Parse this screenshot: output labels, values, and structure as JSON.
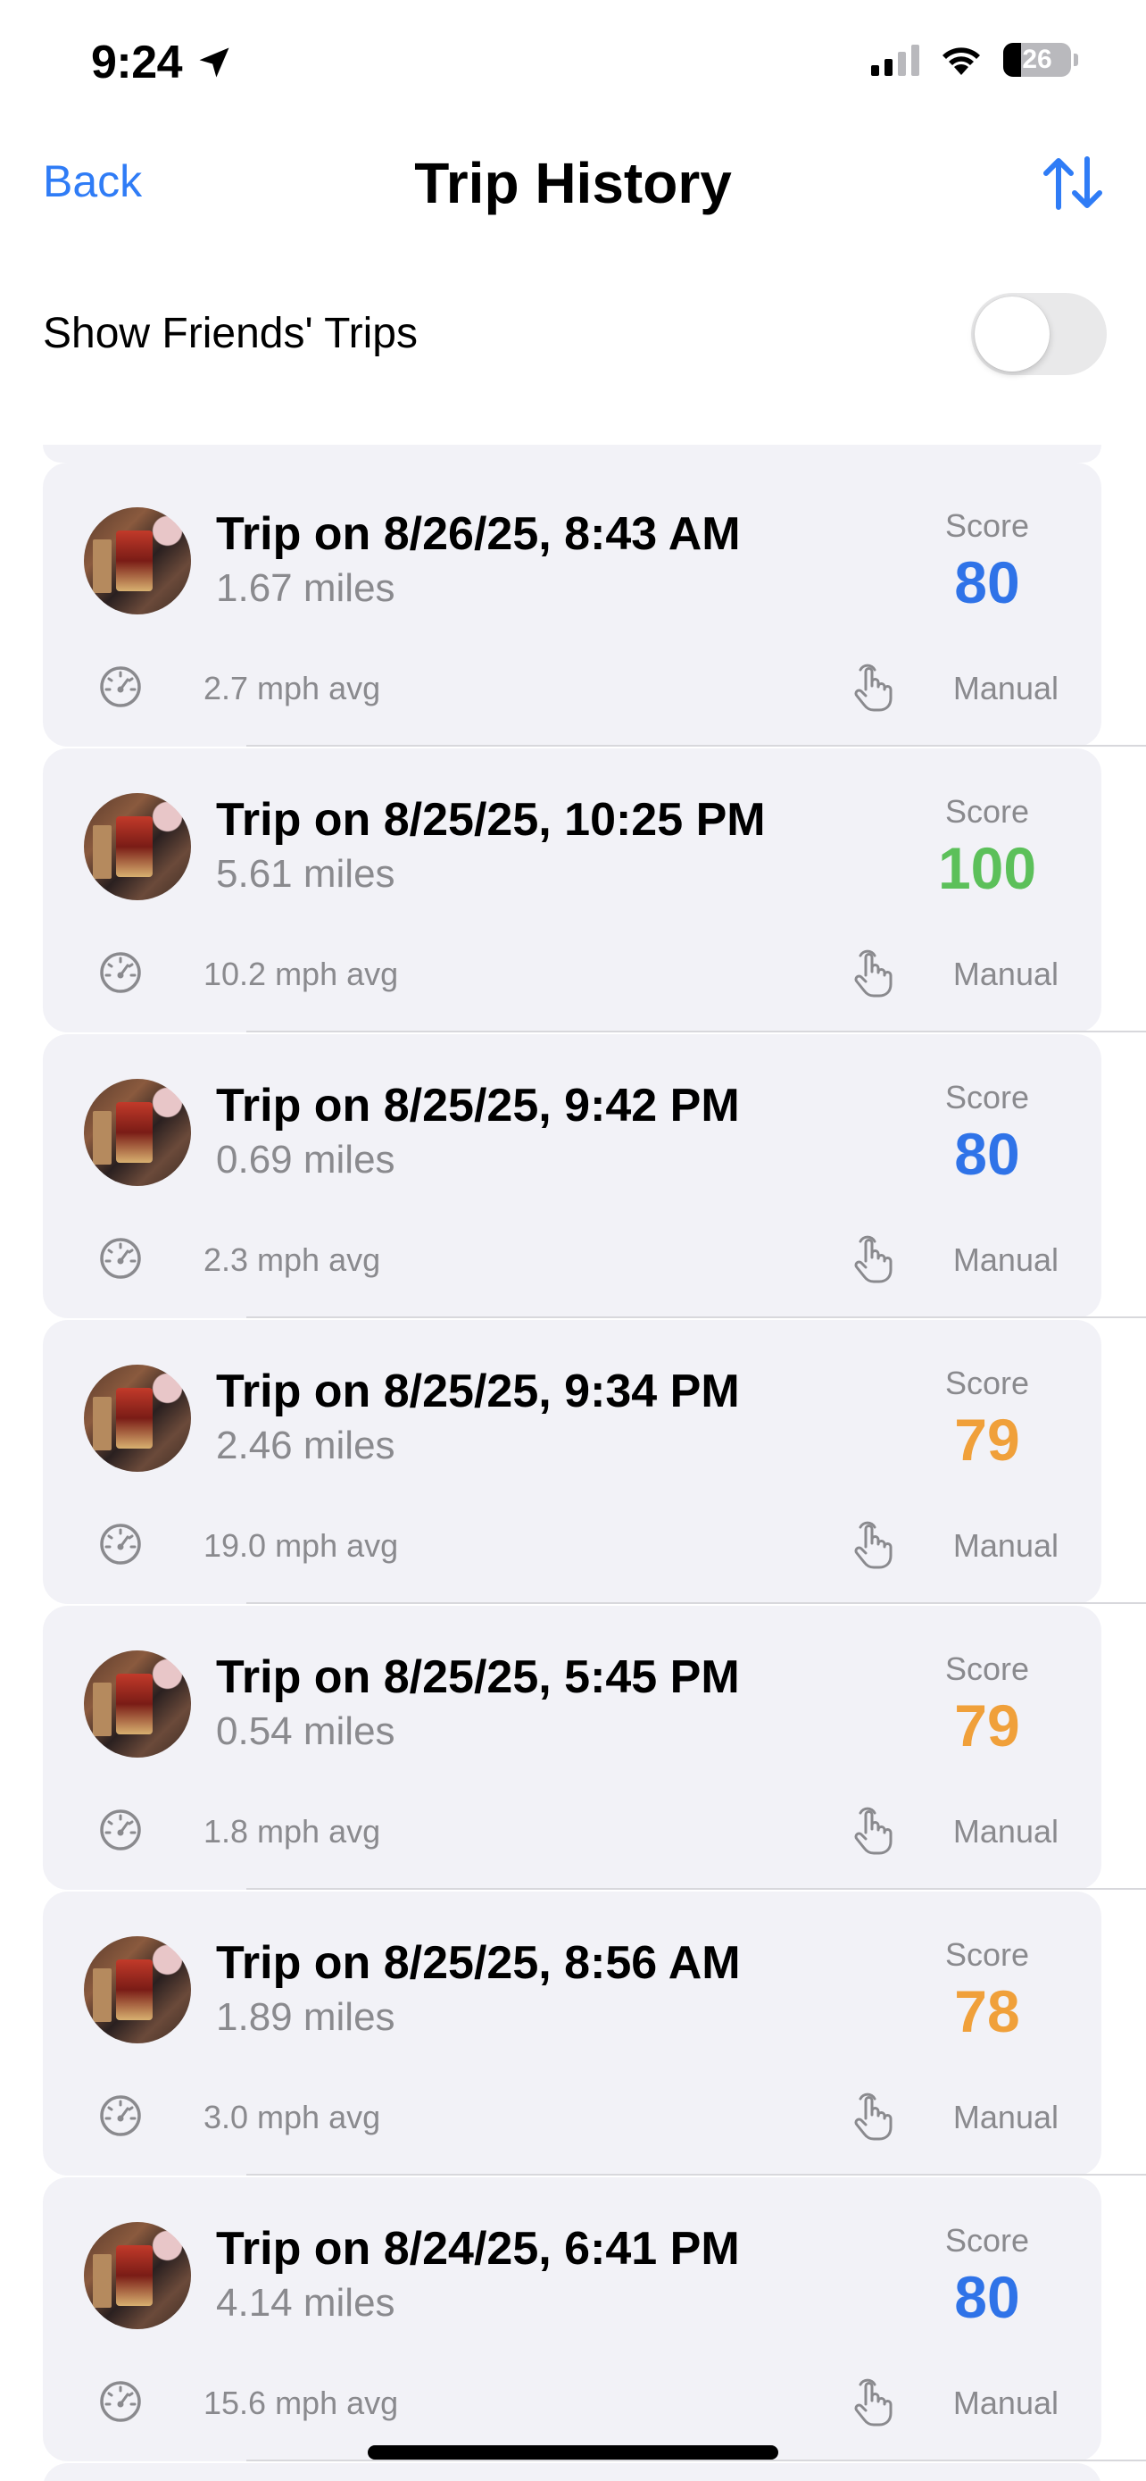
{
  "status_bar": {
    "time": "9:24",
    "battery_level": "26",
    "battery_fraction": 0.26
  },
  "nav": {
    "back_label": "Back",
    "title": "Trip History"
  },
  "friends_toggle": {
    "label": "Show Friends' Trips",
    "on": false
  },
  "colors": {
    "accent": "#2f7cf6",
    "score_blue": "#2f73e8",
    "score_green": "#5cc05a",
    "score_orange": "#f0a03a",
    "card_bg": "#f2f2f7"
  },
  "trips": [
    {
      "title": "Trip on 8/26/25, 8:43 AM",
      "distance": "1.67 miles",
      "score_label": "Score",
      "score": "80",
      "score_color": "#2f73e8",
      "speed": "2.7 mph avg",
      "mode": "Manual"
    },
    {
      "title": "Trip on 8/25/25, 10:25 PM",
      "distance": "5.61 miles",
      "score_label": "Score",
      "score": "100",
      "score_color": "#5cc05a",
      "speed": "10.2 mph avg",
      "mode": "Manual"
    },
    {
      "title": "Trip on 8/25/25, 9:42 PM",
      "distance": "0.69 miles",
      "score_label": "Score",
      "score": "80",
      "score_color": "#2f73e8",
      "speed": "2.3 mph avg",
      "mode": "Manual"
    },
    {
      "title": "Trip on 8/25/25, 9:34 PM",
      "distance": "2.46 miles",
      "score_label": "Score",
      "score": "79",
      "score_color": "#f0a03a",
      "speed": "19.0 mph avg",
      "mode": "Manual"
    },
    {
      "title": "Trip on 8/25/25, 5:45 PM",
      "distance": "0.54 miles",
      "score_label": "Score",
      "score": "79",
      "score_color": "#f0a03a",
      "speed": "1.8 mph avg",
      "mode": "Manual"
    },
    {
      "title": "Trip on 8/25/25, 8:56 AM",
      "distance": "1.89 miles",
      "score_label": "Score",
      "score": "78",
      "score_color": "#f0a03a",
      "speed": "3.0 mph avg",
      "mode": "Manual"
    },
    {
      "title": "Trip on 8/24/25, 6:41 PM",
      "distance": "4.14 miles",
      "score_label": "Score",
      "score": "80",
      "score_color": "#2f73e8",
      "speed": "15.6 mph avg",
      "mode": "Manual"
    }
  ],
  "icons": {
    "location": "location-arrow-icon",
    "signal": "cellular-signal-icon",
    "wifi": "wifi-icon",
    "battery": "battery-icon",
    "sort": "sort-arrows-icon",
    "speed": "speedometer-icon",
    "manual": "hand-tap-icon"
  }
}
